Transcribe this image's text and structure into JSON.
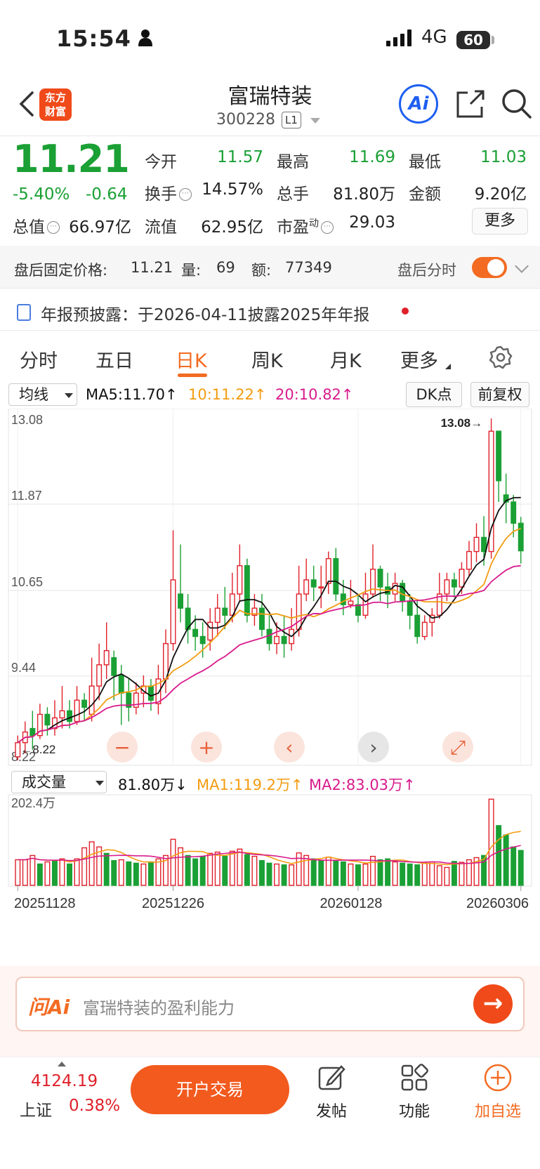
{
  "status_bar": {
    "time": "15:54",
    "network": "4G",
    "battery": "60"
  },
  "header": {
    "logo_line1": "东方",
    "logo_line2": "财富",
    "stock_name": "富瑞特装",
    "stock_code": "300228",
    "level": "L1",
    "ai_label": "Ai"
  },
  "quote": {
    "price": "11.21",
    "change_pct": "-5.40%",
    "change_amt": "-0.64",
    "open_label": "今开",
    "open": "11.57",
    "high_label": "最高",
    "high": "11.69",
    "low_label": "最低",
    "low": "11.03",
    "turnover_label": "换手",
    "turnover": "14.57%",
    "volume_label": "总手",
    "volume": "81.80万",
    "amount_label": "金额",
    "amount": "9.20亿",
    "mktcap_label": "总值",
    "mktcap": "66.97亿",
    "float_label": "流值",
    "float": "62.95亿",
    "pe_label": "市盈",
    "pe_sup": "动",
    "pe": "29.03",
    "more_label": "更多",
    "info_glyph": "⋯"
  },
  "after_hours": {
    "price_label": "盘后固定价格:",
    "price": "11.21",
    "vol_label": "量:",
    "vol": "69",
    "amt_label": "额:",
    "amt": "77349",
    "timeshare_label": "盘后分时"
  },
  "report": {
    "text": "年报预披露：于2026-04-11披露2025年年报"
  },
  "tabs": [
    "分时",
    "五日",
    "日K",
    "周K",
    "月K",
    "更多"
  ],
  "chart_header": {
    "ma_select": "均线",
    "ma5": "MA5:11.70↑",
    "ma10": "10:11.22↑",
    "ma20": "20:10.82↑",
    "dk_label": "DK点",
    "adjust_label": "前复权"
  },
  "volume_header": {
    "select": "成交量",
    "vol": "81.80万↓",
    "ma1": "MA1:119.2万↑",
    "ma2": "MA2:83.03万↑"
  },
  "colors": {
    "up": "#e0202a",
    "down": "#1aa034",
    "ma5": "#111111",
    "ma10": "#f39c12",
    "ma20": "#d81b8c",
    "accent": "#f36b22"
  },
  "chart_data": {
    "type": "candlestick",
    "y_ticks": [
      "13.08",
      "11.87",
      "10.65",
      "9.44",
      "8.22"
    ],
    "ylim": [
      8.22,
      13.08
    ],
    "high_marker": "13.08→",
    "low_marker": "8.22",
    "x_ticks": [
      "20251128",
      "20251226",
      "20260128",
      "20260306"
    ],
    "candles": [
      [
        8.3,
        8.5,
        8.25,
        8.6
      ],
      [
        8.5,
        8.65,
        8.35,
        8.8
      ],
      [
        8.7,
        8.6,
        8.4,
        8.95
      ],
      [
        8.6,
        8.9,
        8.55,
        9.05
      ],
      [
        8.9,
        8.75,
        8.6,
        9.0
      ],
      [
        8.7,
        8.85,
        8.6,
        9.1
      ],
      [
        8.85,
        8.95,
        8.7,
        9.3
      ],
      [
        8.95,
        8.8,
        8.7,
        9.1
      ],
      [
        8.8,
        9.1,
        8.75,
        9.3
      ],
      [
        9.1,
        9.0,
        8.8,
        9.2
      ],
      [
        8.9,
        9.3,
        8.8,
        9.7
      ],
      [
        9.3,
        9.6,
        9.1,
        9.9
      ],
      [
        9.6,
        9.8,
        9.4,
        10.2
      ],
      [
        9.7,
        9.45,
        9.1,
        9.8
      ],
      [
        9.45,
        9.2,
        8.75,
        9.6
      ],
      [
        9.2,
        9.0,
        8.8,
        9.4
      ],
      [
        9.0,
        9.2,
        8.9,
        9.35
      ],
      [
        9.2,
        9.3,
        9.0,
        9.45
      ],
      [
        9.3,
        9.1,
        8.95,
        9.4
      ],
      [
        9.05,
        9.4,
        8.9,
        9.6
      ],
      [
        9.4,
        9.9,
        9.2,
        10.1
      ],
      [
        9.9,
        10.8,
        9.8,
        11.5
      ],
      [
        10.6,
        10.4,
        10.2,
        11.3
      ],
      [
        10.4,
        10.1,
        9.9,
        10.6
      ],
      [
        10.1,
        10.0,
        9.8,
        10.3
      ],
      [
        10.0,
        9.9,
        9.7,
        10.2
      ],
      [
        9.95,
        10.2,
        9.8,
        10.4
      ],
      [
        10.2,
        10.4,
        10.0,
        10.6
      ],
      [
        10.4,
        10.3,
        10.1,
        10.7
      ],
      [
        10.3,
        10.6,
        10.2,
        10.9
      ],
      [
        10.6,
        11.0,
        10.5,
        11.3
      ],
      [
        11.0,
        10.3,
        10.2,
        11.1
      ],
      [
        10.3,
        10.4,
        10.15,
        10.6
      ],
      [
        10.4,
        10.1,
        10.0,
        10.6
      ],
      [
        10.1,
        9.9,
        9.8,
        10.3
      ],
      [
        9.9,
        10.0,
        9.75,
        10.2
      ],
      [
        10.0,
        9.9,
        9.7,
        10.3
      ],
      [
        9.9,
        10.1,
        9.8,
        10.4
      ],
      [
        10.1,
        10.6,
        10.0,
        11.0
      ],
      [
        10.6,
        10.8,
        10.5,
        11.1
      ],
      [
        10.8,
        10.7,
        10.5,
        11.0
      ],
      [
        10.7,
        10.7,
        10.4,
        11.0
      ],
      [
        10.75,
        11.1,
        10.6,
        11.2
      ],
      [
        11.1,
        10.6,
        10.5,
        11.25
      ],
      [
        10.6,
        10.45,
        10.3,
        10.8
      ],
      [
        10.45,
        10.5,
        10.4,
        10.8
      ],
      [
        10.45,
        10.3,
        10.2,
        10.6
      ],
      [
        10.3,
        10.6,
        10.25,
        10.9
      ],
      [
        10.6,
        10.95,
        10.55,
        11.3
      ],
      [
        10.95,
        10.7,
        10.5,
        11.0
      ],
      [
        10.7,
        10.6,
        10.4,
        10.9
      ],
      [
        10.6,
        10.75,
        10.5,
        10.9
      ],
      [
        10.75,
        10.5,
        10.35,
        10.8
      ],
      [
        10.5,
        10.3,
        10.1,
        10.6
      ],
      [
        10.3,
        10.0,
        9.9,
        10.5
      ],
      [
        10.0,
        10.2,
        9.95,
        10.3
      ],
      [
        10.2,
        10.3,
        10.0,
        10.4
      ],
      [
        10.3,
        10.6,
        10.25,
        10.9
      ],
      [
        10.6,
        10.8,
        10.5,
        10.9
      ],
      [
        10.8,
        10.7,
        10.55,
        10.9
      ],
      [
        10.7,
        10.95,
        10.6,
        11.05
      ],
      [
        10.95,
        11.2,
        10.85,
        11.35
      ],
      [
        11.2,
        11.4,
        11.05,
        11.6
      ],
      [
        11.4,
        11.2,
        11.0,
        11.7
      ],
      [
        11.2,
        12.9,
        11.1,
        13.08
      ],
      [
        12.9,
        12.2,
        11.9,
        12.5
      ],
      [
        12.0,
        11.9,
        11.6,
        12.3
      ],
      [
        11.9,
        11.6,
        11.4,
        12.0
      ],
      [
        11.6,
        11.21,
        11.03,
        11.69
      ]
    ],
    "volume": {
      "ylim": [
        0,
        202.4
      ],
      "top_label": "202.4万",
      "values": [
        60,
        60,
        70,
        50,
        55,
        58,
        62,
        50,
        62,
        88,
        102,
        90,
        75,
        58,
        60,
        55,
        52,
        50,
        55,
        62,
        70,
        108,
        88,
        70,
        62,
        68,
        75,
        78,
        68,
        80,
        85,
        72,
        68,
        58,
        52,
        50,
        48,
        48,
        76,
        70,
        62,
        58,
        66,
        58,
        55,
        50,
        48,
        50,
        68,
        60,
        62,
        55,
        52,
        50,
        48,
        52,
        55,
        46,
        42,
        56,
        54,
        60,
        65,
        70,
        202,
        140,
        118,
        90,
        81.8
      ],
      "up_flags": [
        1,
        1,
        1,
        0,
        1,
        0,
        1,
        0,
        1,
        1,
        1,
        1,
        0,
        0,
        1,
        0,
        0,
        1,
        0,
        1,
        1,
        1,
        1,
        0,
        0,
        0,
        1,
        1,
        0,
        1,
        1,
        0,
        1,
        0,
        0,
        1,
        0,
        1,
        1,
        1,
        0,
        0,
        1,
        0,
        0,
        1,
        0,
        1,
        1,
        0,
        0,
        1,
        0,
        0,
        0,
        1,
        1,
        1,
        1,
        0,
        1,
        1,
        1,
        0,
        1,
        0,
        0,
        0,
        0
      ]
    }
  },
  "chart_controls": {
    "zoom_out": "−",
    "zoom_in": "+",
    "prev": "‹",
    "next": "›",
    "fullscreen": "⤢"
  },
  "ask_ai": {
    "logo": "问Ai",
    "placeholder": "富瑞特装的盈利能力",
    "go": "→"
  },
  "bottom_bar": {
    "index_value": "4124.19",
    "index_name": "上证",
    "index_pct": "0.38%",
    "trade_label": "开户交易",
    "post_label": "发帖",
    "function_label": "功能",
    "watchlist_label": "加自选"
  }
}
